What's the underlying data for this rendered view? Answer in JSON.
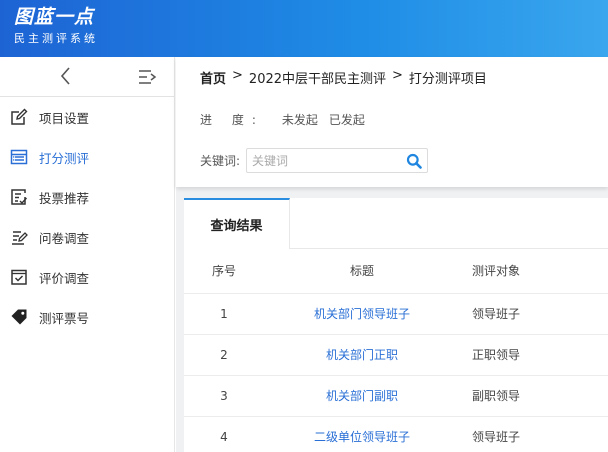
{
  "brand": {
    "title": "图蓝一点",
    "subtitle": "民主测评系统"
  },
  "sidebar": {
    "collapse_icon": "chevron-left-icon",
    "toggle_icon": "menu-collapse-icon",
    "items": [
      {
        "label": "项目设置",
        "icon": "edit-icon",
        "active": false
      },
      {
        "label": "打分测评",
        "icon": "table-icon",
        "active": true
      },
      {
        "label": "投票推荐",
        "icon": "vote-list-icon",
        "active": false
      },
      {
        "label": "问卷调查",
        "icon": "questionnaire-icon",
        "active": false
      },
      {
        "label": "评价调查",
        "icon": "check-box-icon",
        "active": false
      },
      {
        "label": "测评票号",
        "icon": "tag-icon",
        "active": false
      }
    ]
  },
  "breadcrumb": {
    "home": "首页",
    "sep": ">",
    "level2": "2022中层干部民主测评",
    "level3": "打分测评项目"
  },
  "filters": {
    "progress_label": "进 度:",
    "progress_options": [
      "未发起",
      "已发起"
    ],
    "keyword_label": "关键词:",
    "keyword_placeholder": "关键词",
    "keyword_value": ""
  },
  "results": {
    "tab_label": "查询结果",
    "columns": [
      "序号",
      "标题",
      "测评对象"
    ],
    "rows": [
      {
        "no": "1",
        "title": "机关部门领导班子",
        "target": "领导班子"
      },
      {
        "no": "2",
        "title": "机关部门正职",
        "target": "正职领导"
      },
      {
        "no": "3",
        "title": "机关部门副职",
        "target": "副职领导"
      },
      {
        "no": "4",
        "title": "二级单位领导班子",
        "target": "领导班子"
      }
    ]
  },
  "colors": {
    "accent": "#2a6fd6",
    "header_start": "#1d63d4",
    "header_end": "#3aa6ee",
    "tab_border": "#2a8de0"
  }
}
